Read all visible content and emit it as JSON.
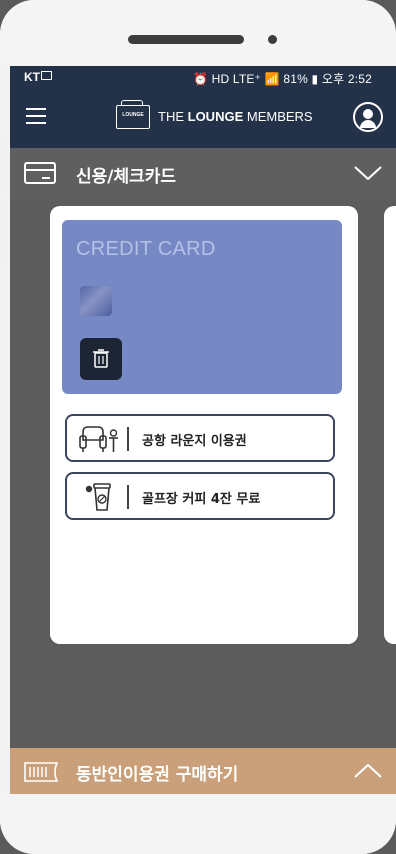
{
  "status": {
    "carrier": "KT",
    "right": "⏰ HD LTE⁺ 📶 81% ▮ 오후 2:52",
    "battery": "81%",
    "time": "오후 2:52"
  },
  "app": {
    "logo_text": "THE LOUNGE MEMBERS",
    "brand_prefix": "THE ",
    "brand_bold": "LOUNGE",
    "brand_suffix": " MEMBERS"
  },
  "section": {
    "title": "신용/체크카드"
  },
  "card": {
    "title": "CREDIT CARD",
    "color": "#7689c5"
  },
  "benefits": [
    {
      "label": "공항 라운지 이용권",
      "icon": "lounge-chair-icon"
    },
    {
      "label": "골프장 커피 4잔 무료",
      "icon": "coffee-cup-icon"
    }
  ],
  "bottom": {
    "title": "동반인이용권 구매하기",
    "color": "#c9a079"
  },
  "colors": {
    "header": "#233149",
    "screen_bg": "#5c5c5c"
  }
}
